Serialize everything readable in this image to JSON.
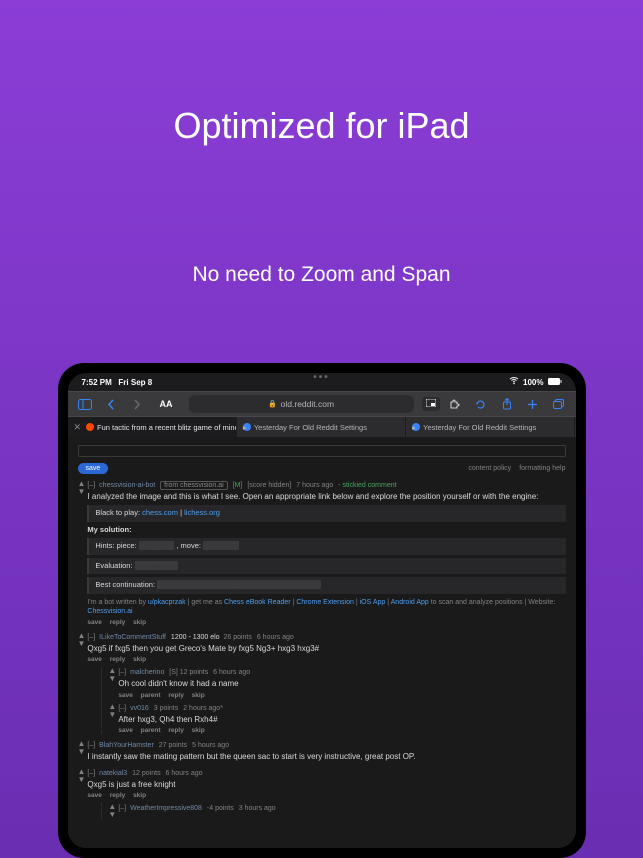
{
  "hero": {
    "title": "Optimized for iPad",
    "subtitle": "No need to Zoom and Span"
  },
  "status": {
    "time": "7:52 PM",
    "date": "Fri Sep 8",
    "battery": "100%",
    "wifi": "●"
  },
  "toolbar": {
    "url": "old.reddit.com",
    "aa": "AA"
  },
  "tabs": [
    {
      "label": "Fun tactic from a recent blitz game of mine :...",
      "active": true
    },
    {
      "label": "Yesterday For Old Reddit Settings",
      "active": false
    },
    {
      "label": "Yesterday For Old Reddit Settings",
      "active": false
    }
  ],
  "footer": {
    "save": "save",
    "policy": "content policy",
    "help": "formatting help"
  },
  "comments": [
    {
      "toggle": "[–]",
      "author": "chessvision-ai-bot",
      "flair": "from chessvision.ai",
      "mod": "[M]",
      "score": "[score hidden]",
      "time": "7 hours ago",
      "stickied": "- stickied comment",
      "body_line1": "I analyzed the image and this is what I see. Open an appropriate link below and explore the position yourself or with the engine:",
      "black_to_play": "Black to play",
      "link_chess": "chess.com",
      "link_lichess": "lichess.org",
      "sol_title": "My solution:",
      "hints_label": "Hints: piece:",
      "move_label": ", move:",
      "eval_label": "Evaluation:",
      "best_label": "Best continuation:",
      "bot_line1": "I'm a bot written by ",
      "bot_author": "u/pkacprzak",
      "bot_line2": " | get me as ",
      "bot_link1": "Chess eBook Reader",
      "bot_link2": "Chrome Extension",
      "bot_link3": "iOS App",
      "bot_link4": "Android App",
      "bot_line3": " to scan and analyze positions | Website: ",
      "bot_site": "Chessvision.ai"
    },
    {
      "toggle": "[–]",
      "author": "ILikeToCommentStuff",
      "flair": "1200 - 1300 elo",
      "score": "26 points",
      "time": "6 hours ago",
      "body": "Qxg5 if fxg5 then you get Greco's Mate by fxg5 Ng3+ hxg3 hxg3#"
    },
    {
      "toggle": "[–]",
      "author": "malcherino",
      "score": "[S] 12 points",
      "time": "6 hours ago",
      "body": "Oh cool didn't know it had a name"
    },
    {
      "toggle": "[–]",
      "author": "vv016",
      "score": "3 points",
      "time": "2 hours ago*",
      "body": "After hxg3, Qh4 then Rxh4#"
    },
    {
      "toggle": "[–]",
      "author": "BlahYourHamster",
      "score": "27 points",
      "time": "5 hours ago",
      "body": "I instantly saw the mating pattern but the queen sac to start is very instructive, great post OP."
    },
    {
      "toggle": "[–]",
      "author": "natekial3",
      "score": "12 points",
      "time": "6 hours ago",
      "body": "Qxg5 is just a free knight"
    },
    {
      "toggle": "[–]",
      "author": "WeatherImpressive808",
      "score": "-4 points",
      "time": "3 hours ago"
    }
  ],
  "actions": {
    "save": "save",
    "reply": "reply",
    "skip": "skip",
    "parent": "parent"
  }
}
